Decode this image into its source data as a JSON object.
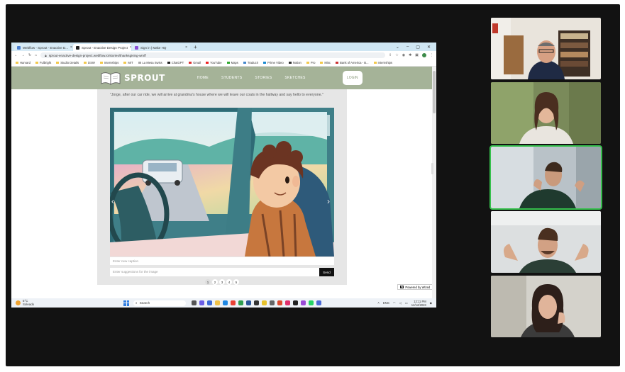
{
  "browser": {
    "tabs": [
      {
        "label": "Webflow - Sprout - Enactive D...",
        "active": false
      },
      {
        "label": "Sprout - Enactive Design Project",
        "active": true
      },
      {
        "label": "Sign in | Make HQ",
        "active": false
      }
    ],
    "new_tab_label": "+",
    "window_controls": [
      "⌄",
      "–",
      "▢",
      "✕"
    ],
    "url": "sprout-enactive-design-project.webflow.io/stories/thanksgiving-wrxff",
    "bookmarks": [
      "Harvard",
      "Fulbright",
      "Studio Details",
      "DSW",
      "Internships",
      "MIT",
      "La Mesa Swiss",
      "ChatGPT",
      "Gmail",
      "YouTube",
      "Maps",
      "Traducir",
      "Prime Video",
      "Notion",
      "Pro",
      "Misc",
      "Bank of America - B...",
      "Internships"
    ]
  },
  "site": {
    "logo_text": "SPROUT",
    "menu": [
      "HOME",
      "STUDENTS",
      "STORIES",
      "SKETCHES"
    ],
    "login_label": "LOGIN",
    "quote": "\"Jorge, after our car ride, we will arrive at grandma's house where we will leave our coats in the hallway and say hello to everyone.\"",
    "caption_placeholder": "Enter new caption",
    "suggestion_placeholder": "Enter suggestions for the image",
    "send_label": "Send",
    "pages": [
      "1",
      "2",
      "3",
      "4",
      "5"
    ],
    "active_page": "1",
    "prev_arrow": "‹",
    "next_arrow": "›",
    "badge_logo": "W",
    "badge_label": "Powered by Wized"
  },
  "taskbar": {
    "weather_temp": "5°C",
    "weather_desc": "Soleado",
    "search_label": "Search",
    "lang": "ENG",
    "time": "12:11 PM",
    "date": "12/12/2023"
  },
  "participants": [
    {
      "name": "participant-1",
      "speaking": false
    },
    {
      "name": "participant-2",
      "speaking": false
    },
    {
      "name": "participant-3",
      "speaking": true
    },
    {
      "name": "participant-4",
      "speaking": false
    },
    {
      "name": "participant-5",
      "speaking": false
    }
  ],
  "colors": {
    "nav_green": "#a5b398",
    "speaking_border": "#36c04d",
    "meeting_bg": "#121212"
  }
}
